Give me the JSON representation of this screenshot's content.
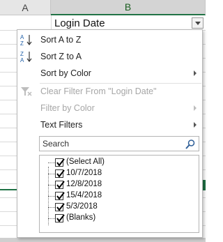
{
  "columns": {
    "a": "A",
    "b": "B"
  },
  "cell_b1": "Login Date",
  "menu": {
    "items": [
      {
        "label": "Sort A to Z",
        "icon": "sort-a-to-z-icon"
      },
      {
        "label": "Sort Z to A",
        "icon": "sort-z-to-a-icon"
      },
      {
        "label": "Sort by Color",
        "icon": ""
      },
      {
        "label": "Clear Filter From \"Login Date\"",
        "icon": "clear-filter-icon"
      },
      {
        "label": "Filter by Color",
        "icon": ""
      },
      {
        "label": "Text Filters",
        "icon": ""
      }
    ]
  },
  "search": {
    "placeholder": "Search"
  },
  "list": [
    {
      "label": "(Select All)",
      "checked": true
    },
    {
      "label": "10/7/2018",
      "checked": true
    },
    {
      "label": "12/8/2018",
      "checked": true
    },
    {
      "label": "15/4/2018",
      "checked": true
    },
    {
      "label": "5/3/2018",
      "checked": true
    },
    {
      "label": "(Blanks)",
      "checked": true
    }
  ],
  "colors": {
    "excel_green": "#217346",
    "disabled": "#a6a6a6"
  }
}
